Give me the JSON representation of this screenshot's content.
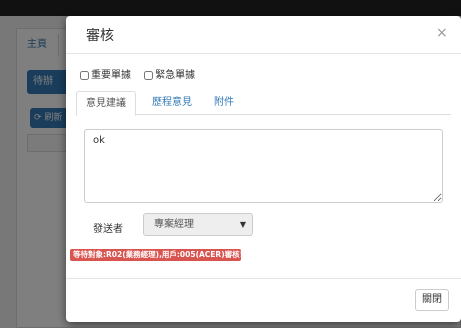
{
  "background": {
    "tab_main": "主頁",
    "pending_label": "待辦",
    "refresh_label": "刷新"
  },
  "modal": {
    "title": "審核",
    "close_glyph": "×",
    "checkboxes": [
      {
        "label": "重要單據",
        "checked": false
      },
      {
        "label": "緊急單據",
        "checked": false
      }
    ],
    "tabs": [
      {
        "label": "意見建議",
        "active": true
      },
      {
        "label": "歷程意見",
        "active": false
      },
      {
        "label": "附件",
        "active": false
      }
    ],
    "comment_value": "ok",
    "sender_label": "發送者",
    "sender_selected": "專案經理",
    "alert_text": "等待對象:R02(業務經理),用戶:005(ACER)審核!",
    "close_button": "關閉"
  },
  "colors": {
    "primary": "#337ab7",
    "danger": "#d9534f"
  }
}
